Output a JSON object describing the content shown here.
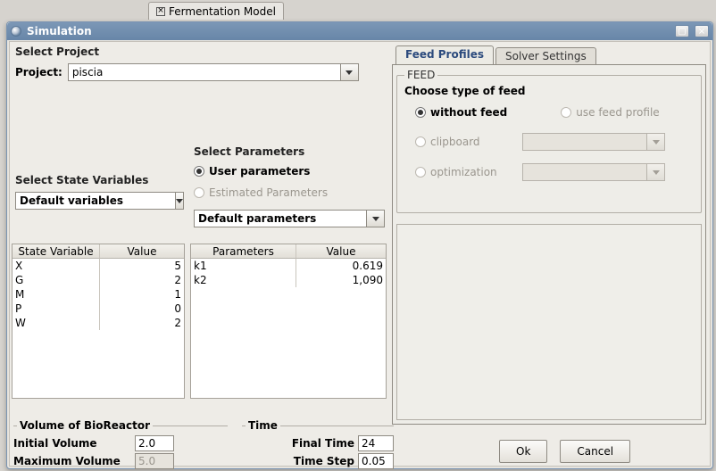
{
  "window": {
    "bg_tab_label": "Fermentation Model",
    "title": "Simulation"
  },
  "project": {
    "section_label": "Select Project",
    "label": "Project:",
    "value": "piscia"
  },
  "state_vars": {
    "section_label": "Select State Variables",
    "combo_value": "Default variables",
    "table_headers": {
      "name": "State Variable",
      "value": "Value"
    },
    "rows": [
      {
        "name": "X",
        "value": "5"
      },
      {
        "name": "G",
        "value": "2"
      },
      {
        "name": "M",
        "value": "1"
      },
      {
        "name": "P",
        "value": "0"
      },
      {
        "name": "W",
        "value": "2"
      }
    ]
  },
  "params": {
    "section_label": "Select Parameters",
    "radios": {
      "user": "User parameters",
      "estimated": "Estimated Parameters"
    },
    "combo_value": "Default parameters",
    "table_headers": {
      "name": "Parameters",
      "value": "Value"
    },
    "rows": [
      {
        "name": "k1",
        "value": "0.619"
      },
      {
        "name": "k2",
        "value": "1,090"
      }
    ]
  },
  "reactor": {
    "section": "Volume of BioReactor",
    "initial_label": "Initial Volume",
    "initial_value": "2.0",
    "max_label": "Maximum Volume",
    "max_value": "5.0"
  },
  "time": {
    "section": "Time",
    "final_label": "Final Time",
    "final_value": "24",
    "step_label": "Time Step",
    "step_value": "0.05"
  },
  "tabs": {
    "feed": "Feed Profiles",
    "solver": "Solver Settings"
  },
  "feed": {
    "group": "FEED",
    "choose": "Choose type of feed",
    "without": "without feed",
    "use_profile": "use feed profile",
    "clipboard": "clipboard",
    "optimization": "optimization"
  },
  "buttons": {
    "ok": "Ok",
    "cancel": "Cancel"
  }
}
